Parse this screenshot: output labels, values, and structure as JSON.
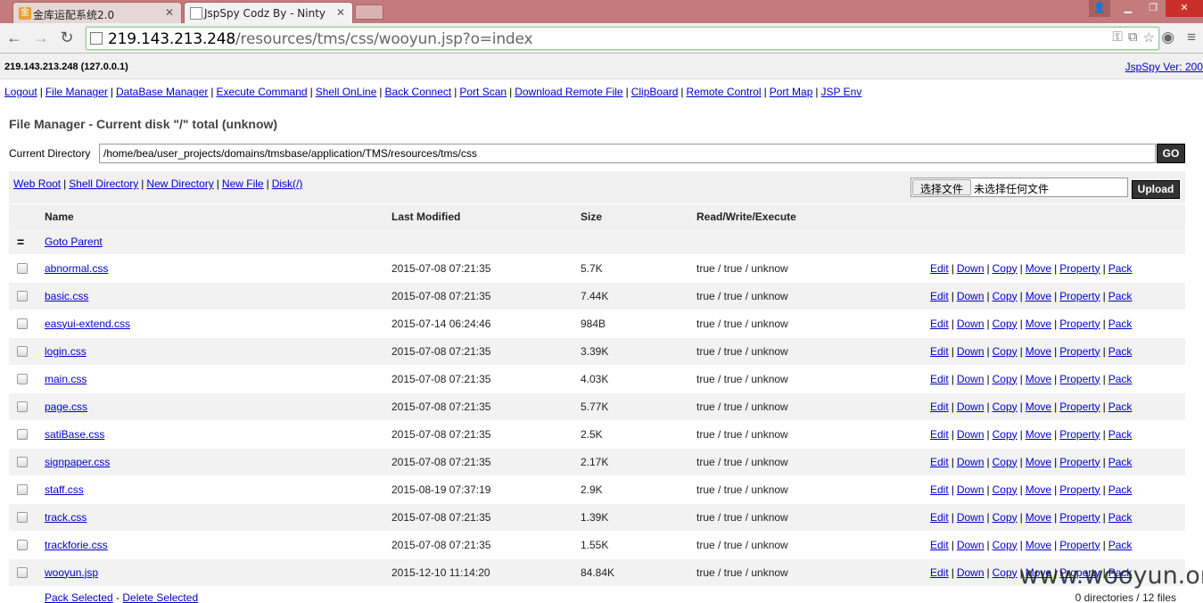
{
  "browser": {
    "tabs": [
      {
        "label": "金库运配系统2.0",
        "active": false
      },
      {
        "label": "JspSpy Codz By - Ninty",
        "active": true
      }
    ],
    "url_host": "219.143.213.248",
    "url_path": "/resources/tms/css/wooyun.jsp?o=index"
  },
  "header": {
    "host": "219.143.213.248 (127.0.0.1)",
    "version": "JspSpy Ver: 200"
  },
  "menu": [
    "Logout",
    "File Manager",
    "DataBase Manager",
    "Execute Command",
    "Shell OnLine",
    "Back Connect",
    "Port Scan",
    "Download Remote File",
    "ClipBoard",
    "Remote Control",
    "Port Map",
    "JSP Env"
  ],
  "page_title": "File Manager - Current disk \"/\" total (unknow)",
  "current_dir": {
    "label": "Current Directory",
    "value": "/home/bea/user_projects/domains/tmsbase/application/TMS/resources/tms/css",
    "go": "GO"
  },
  "quick_links": [
    "Web Root",
    "Shell Directory",
    "New Directory",
    "New File",
    "Disk(/)"
  ],
  "upload": {
    "choose": "选择文件",
    "nofile": "未选择任何文件",
    "button": "Upload"
  },
  "table": {
    "headers": [
      "Name",
      "Last Modified",
      "Size",
      "Read/Write/Execute"
    ],
    "parent": "Goto Parent",
    "actions": [
      "Edit",
      "Down",
      "Copy",
      "Move",
      "Property",
      "Pack"
    ],
    "rows": [
      {
        "name": "abnormal.css",
        "modified": "2015-07-08 07:21:35",
        "size": "5.7K",
        "rwx": "true / true / unknow"
      },
      {
        "name": "basic.css",
        "modified": "2015-07-08 07:21:35",
        "size": "7.44K",
        "rwx": "true / true / unknow"
      },
      {
        "name": "easyui-extend.css",
        "modified": "2015-07-14 06:24:46",
        "size": "984B",
        "rwx": "true / true / unknow"
      },
      {
        "name": "login.css",
        "modified": "2015-07-08 07:21:35",
        "size": "3.39K",
        "rwx": "true / true / unknow"
      },
      {
        "name": "main.css",
        "modified": "2015-07-08 07:21:35",
        "size": "4.03K",
        "rwx": "true / true / unknow"
      },
      {
        "name": "page.css",
        "modified": "2015-07-08 07:21:35",
        "size": "5.77K",
        "rwx": "true / true / unknow"
      },
      {
        "name": "satiBase.css",
        "modified": "2015-07-08 07:21:35",
        "size": "2.5K",
        "rwx": "true / true / unknow"
      },
      {
        "name": "signpaper.css",
        "modified": "2015-07-08 07:21:35",
        "size": "2.17K",
        "rwx": "true / true / unknow"
      },
      {
        "name": "staff.css",
        "modified": "2015-08-19 07:37:19",
        "size": "2.9K",
        "rwx": "true / true / unknow"
      },
      {
        "name": "track.css",
        "modified": "2015-07-08 07:21:35",
        "size": "1.39K",
        "rwx": "true / true / unknow"
      },
      {
        "name": "trackforie.css",
        "modified": "2015-07-08 07:21:35",
        "size": "1.55K",
        "rwx": "true / true / unknow"
      },
      {
        "name": "wooyun.jsp",
        "modified": "2015-12-10 11:14:20",
        "size": "84.84K",
        "rwx": "true / true / unknow"
      }
    ]
  },
  "footer": {
    "pack_selected": "Pack Selected",
    "dash": " - ",
    "delete_selected": "Delete Selected",
    "summary": "0 directories / 12 files"
  },
  "watermark": "www.wooyun.org"
}
